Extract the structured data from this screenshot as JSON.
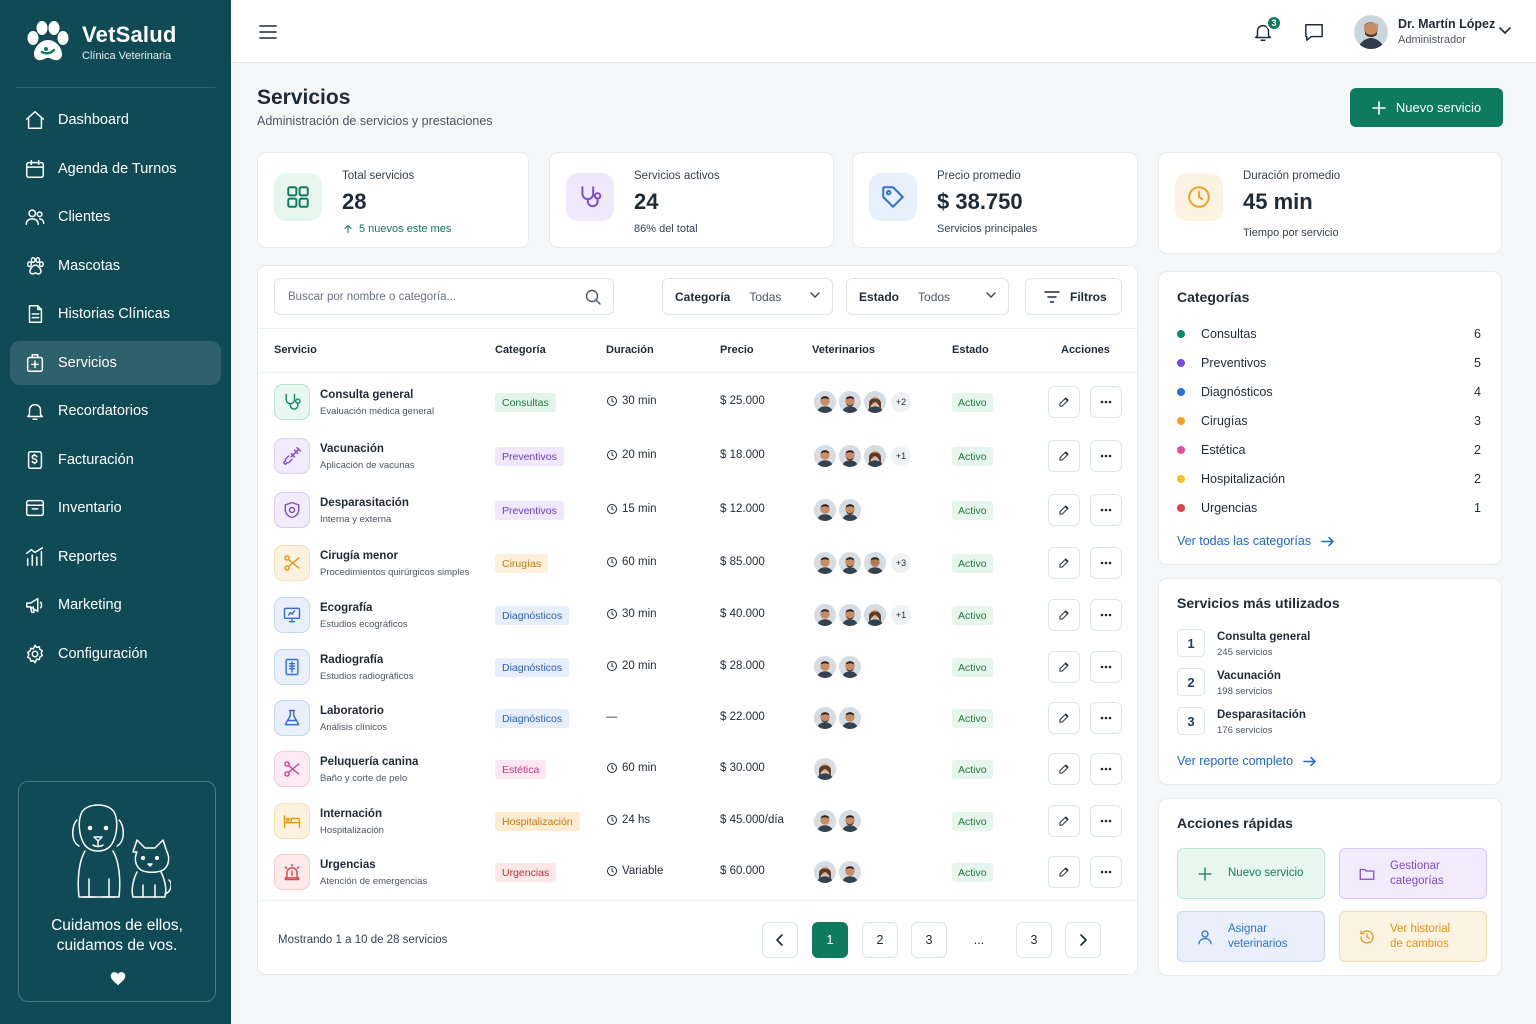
{
  "brand": {
    "name": "VetSalud",
    "subtitle": "Clínica Veterinaria"
  },
  "nav": [
    {
      "label": "Dashboard",
      "icon": "home-icon"
    },
    {
      "label": "Agenda de Turnos",
      "icon": "calendar-icon"
    },
    {
      "label": "Clientes",
      "icon": "users-icon"
    },
    {
      "label": "Mascotas",
      "icon": "paw-icon"
    },
    {
      "label": "Historias Clínicas",
      "icon": "document-icon"
    },
    {
      "label": "Servicios",
      "icon": "medical-plus-icon",
      "active": true
    },
    {
      "label": "Recordatorios",
      "icon": "bell-icon"
    },
    {
      "label": "Facturación",
      "icon": "invoice-icon"
    },
    {
      "label": "Inventario",
      "icon": "box-icon"
    },
    {
      "label": "Reportes",
      "icon": "bar-chart-icon"
    },
    {
      "label": "Marketing",
      "icon": "megaphone-icon"
    },
    {
      "label": "Configuración",
      "icon": "gear-icon"
    }
  ],
  "promo": {
    "text": "Cuidamos de ellos,\ncuidamos de vos."
  },
  "topbar": {
    "notifications": "3",
    "user_name": "Dr. Martín López",
    "user_role": "Administrador"
  },
  "page": {
    "title": "Servicios",
    "subtitle": "Administración de servicios y prestaciones",
    "new_button": "Nuevo servicio"
  },
  "stats": [
    {
      "label": "Total servicios",
      "value": "28",
      "note": "5 nuevos este mes",
      "icon": "grid-icon",
      "color": "#0e7a5e",
      "bg": "#e7f6ef"
    },
    {
      "label": "Servicios activos",
      "value": "24",
      "note": "86% del total",
      "icon": "stethoscope-icon",
      "color": "#7b4bd1",
      "bg": "#efe9fb"
    },
    {
      "label": "Precio promedio",
      "value": "$ 38.750",
      "note": "Servicios principales",
      "icon": "tag-icon",
      "color": "#2f6fd6",
      "bg": "#e8f0fb"
    },
    {
      "label": "Duración promedio",
      "value": "45 min",
      "note": "Tiempo por servicio",
      "icon": "clock-icon",
      "color": "#f0a020",
      "bg": "#fdf3e2"
    }
  ],
  "filters": {
    "search_placeholder": "Buscar por nombre o categoría...",
    "category_label": "Categoría",
    "category_value": "Todas",
    "status_label": "Estado",
    "status_value": "Todos",
    "filters_button": "Filtros"
  },
  "table": {
    "headers": [
      "Servicio",
      "Categoría",
      "Duración",
      "Precio",
      "Veterinarios",
      "Estado",
      "Acciones"
    ],
    "rows": [
      {
        "name": "Consulta general",
        "desc": "Evaluación médica general",
        "category": "Consultas",
        "duration": "30 min",
        "price": "$ 25.000",
        "vets": [
          "m1",
          "m2",
          "f1"
        ],
        "extra": "+2",
        "status": "Activo",
        "icon": "stethoscope-icon",
        "color": "#0e8a6a",
        "bg": "#e9f7f1",
        "pill_bg": "#e3f4ea",
        "pill_fg": "#1f7a3d"
      },
      {
        "name": "Vacunación",
        "desc": "Aplicación de vacunas",
        "category": "Preventivos",
        "duration": "20 min",
        "price": "$ 18.000",
        "vets": [
          "m1",
          "m2",
          "f1"
        ],
        "extra": "+1",
        "status": "Activo",
        "icon": "syringe-icon",
        "color": "#7b4bd1",
        "bg": "#f1ebfb",
        "pill_bg": "#efe7fb",
        "pill_fg": "#6b3fc4"
      },
      {
        "name": "Desparasitación",
        "desc": "Interna y externa",
        "category": "Preventivos",
        "duration": "15 min",
        "price": "$ 12.000",
        "vets": [
          "m1",
          "m2"
        ],
        "extra": "",
        "status": "Activo",
        "icon": "shield-icon",
        "color": "#7b4bd1",
        "bg": "#f1ebfb",
        "pill_bg": "#efe7fb",
        "pill_fg": "#6b3fc4"
      },
      {
        "name": "Cirugía menor",
        "desc": "Procedimientos quirúrgicos simples",
        "category": "Cirugías",
        "duration": "60 min",
        "price": "$ 85.000",
        "vets": [
          "m1",
          "m2",
          "m3"
        ],
        "extra": "+3",
        "status": "Activo",
        "icon": "scissors-icon",
        "color": "#e89414",
        "bg": "#fdf2e0",
        "pill_bg": "#fdf0dc",
        "pill_fg": "#c27a0e"
      },
      {
        "name": "Ecografía",
        "desc": "Estudios ecográficos",
        "category": "Diagnósticos",
        "duration": "30 min",
        "price": "$ 40.000",
        "vets": [
          "m1",
          "m2",
          "f1"
        ],
        "extra": "+1",
        "status": "Activo",
        "icon": "monitor-icon",
        "color": "#2f6fd6",
        "bg": "#e9f0fb",
        "pill_bg": "#e6eefb",
        "pill_fg": "#2a5fb9"
      },
      {
        "name": "Radiografía",
        "desc": "Estudios radiográficos",
        "category": "Diagnósticos",
        "duration": "20 min",
        "price": "$ 28.000",
        "vets": [
          "m1",
          "m2"
        ],
        "extra": "",
        "status": "Activo",
        "icon": "xray-icon",
        "color": "#2f6fd6",
        "bg": "#e9f0fb",
        "pill_bg": "#e6eefb",
        "pill_fg": "#2a5fb9"
      },
      {
        "name": "Laboratorio",
        "desc": "Análisis clínicos",
        "category": "Diagnósticos",
        "duration": "—",
        "price": "$ 22.000",
        "vets": [
          "m2",
          "m1"
        ],
        "extra": "",
        "status": "Activo",
        "icon": "flask-icon",
        "color": "#2f6fd6",
        "bg": "#e9f0fb",
        "pill_bg": "#e6eefb",
        "pill_fg": "#2a5fb9"
      },
      {
        "name": "Peluquería canina",
        "desc": "Baño y corte de pelo",
        "category": "Estética",
        "duration": "60 min",
        "price": "$ 30.000",
        "vets": [
          "f1"
        ],
        "extra": "",
        "status": "Activo",
        "icon": "scissors-icon",
        "color": "#d9408f",
        "bg": "#fcebf4",
        "pill_bg": "#fce8f2",
        "pill_fg": "#c2367d"
      },
      {
        "name": "Internación",
        "desc": "Hospitalización",
        "category": "Hospitalización",
        "duration": "24 hs",
        "price": "$ 45.000/día",
        "vets": [
          "m1",
          "m2"
        ],
        "extra": "",
        "status": "Activo",
        "icon": "bed-icon",
        "color": "#e89414",
        "bg": "#fdf2e0",
        "pill_bg": "#fdecd2",
        "pill_fg": "#c27a0e"
      },
      {
        "name": "Urgencias",
        "desc": "Atención de emergencias",
        "category": "Urgencias",
        "duration": "Variable",
        "price": "$ 60.000",
        "vets": [
          "f1",
          "m1"
        ],
        "extra": "",
        "status": "Activo",
        "icon": "siren-icon",
        "color": "#e0434d",
        "bg": "#fdeaea",
        "pill_bg": "#fde7e7",
        "pill_fg": "#c9323b"
      }
    ]
  },
  "pagination": {
    "summary": "Mostrando 1 a 10 de 28 servicios",
    "pages": [
      "1",
      "2",
      "3",
      "...",
      "3"
    ]
  },
  "categories": {
    "title": "Categorías",
    "items": [
      {
        "name": "Consultas",
        "count": "6",
        "color": "#0e8a6a"
      },
      {
        "name": "Preventivos",
        "count": "5",
        "color": "#7b4bd1"
      },
      {
        "name": "Diagnósticos",
        "count": "4",
        "color": "#2f6fd6"
      },
      {
        "name": "Cirugías",
        "count": "3",
        "color": "#f0a020"
      },
      {
        "name": "Estética",
        "count": "2",
        "color": "#e0509c"
      },
      {
        "name": "Hospitalización",
        "count": "2",
        "color": "#f4c02a"
      },
      {
        "name": "Urgencias",
        "count": "1",
        "color": "#e0434d"
      }
    ],
    "link": "Ver todas las categorías"
  },
  "most_used": {
    "title": "Servicios más utilizados",
    "items": [
      {
        "rank": "1",
        "name": "Consulta general",
        "count": "245 servicios"
      },
      {
        "rank": "2",
        "name": "Vacunación",
        "count": "198 servicios"
      },
      {
        "rank": "3",
        "name": "Desparasitación",
        "count": "176 servicios"
      }
    ],
    "link": "Ver reporte completo"
  },
  "quick_actions": {
    "title": "Acciones rápidas",
    "items": [
      {
        "label": "Nuevo servicio",
        "icon": "plus-icon",
        "color": "#0e7a5e",
        "bg": "#e9f7f1",
        "border": "#bfe6d6"
      },
      {
        "label": "Gestionar\ncategorías",
        "icon": "folder-icon",
        "color": "#7b4bd1",
        "bg": "#f1ebfb",
        "border": "#d9c9f5"
      },
      {
        "label": "Asignar\nveterinarios",
        "icon": "user-icon",
        "color": "#2f6fd6",
        "bg": "#e9f0fb",
        "border": "#c6d8f5"
      },
      {
        "label": "Ver historial\nde cambios",
        "icon": "history-icon",
        "color": "#e89414",
        "bg": "#fdf3e2",
        "border": "#f6dcae"
      }
    ]
  }
}
